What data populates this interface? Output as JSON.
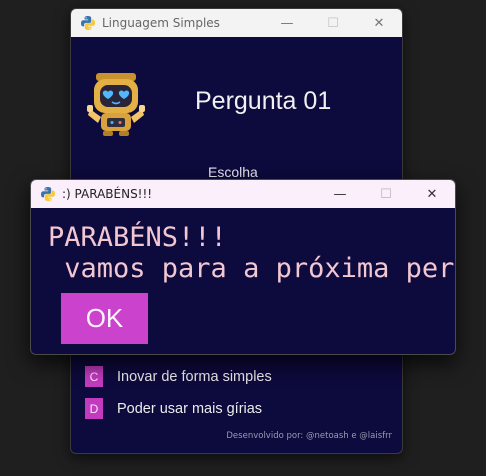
{
  "main_window": {
    "title": "Linguagem Simples",
    "question_title": "Pergunta 01",
    "instruction": "Escolha",
    "options": [
      {
        "letter": "C",
        "text": "Inovar de forma simples"
      },
      {
        "letter": "D",
        "text": "Poder usar mais gírias"
      }
    ],
    "footer": "Desenvolvido por: @netoash e @laisfrr"
  },
  "dialog": {
    "title": ":) PARABÉNS!!!",
    "message": "PARABÉNS!!!\n vamos para a próxima pergunta",
    "ok_label": "OK"
  },
  "titlebar_controls": {
    "minimize": "—",
    "maximize": "☐",
    "close": "✕"
  },
  "icons": {
    "app": "python-logo-icon",
    "mascot": "robot-heart-eyes-icon"
  },
  "colors": {
    "window_bg": "#0d0a3d",
    "option_accent": "#c23bbf",
    "ok_button": "#cb43cc",
    "message_text": "#f3c7d2"
  }
}
